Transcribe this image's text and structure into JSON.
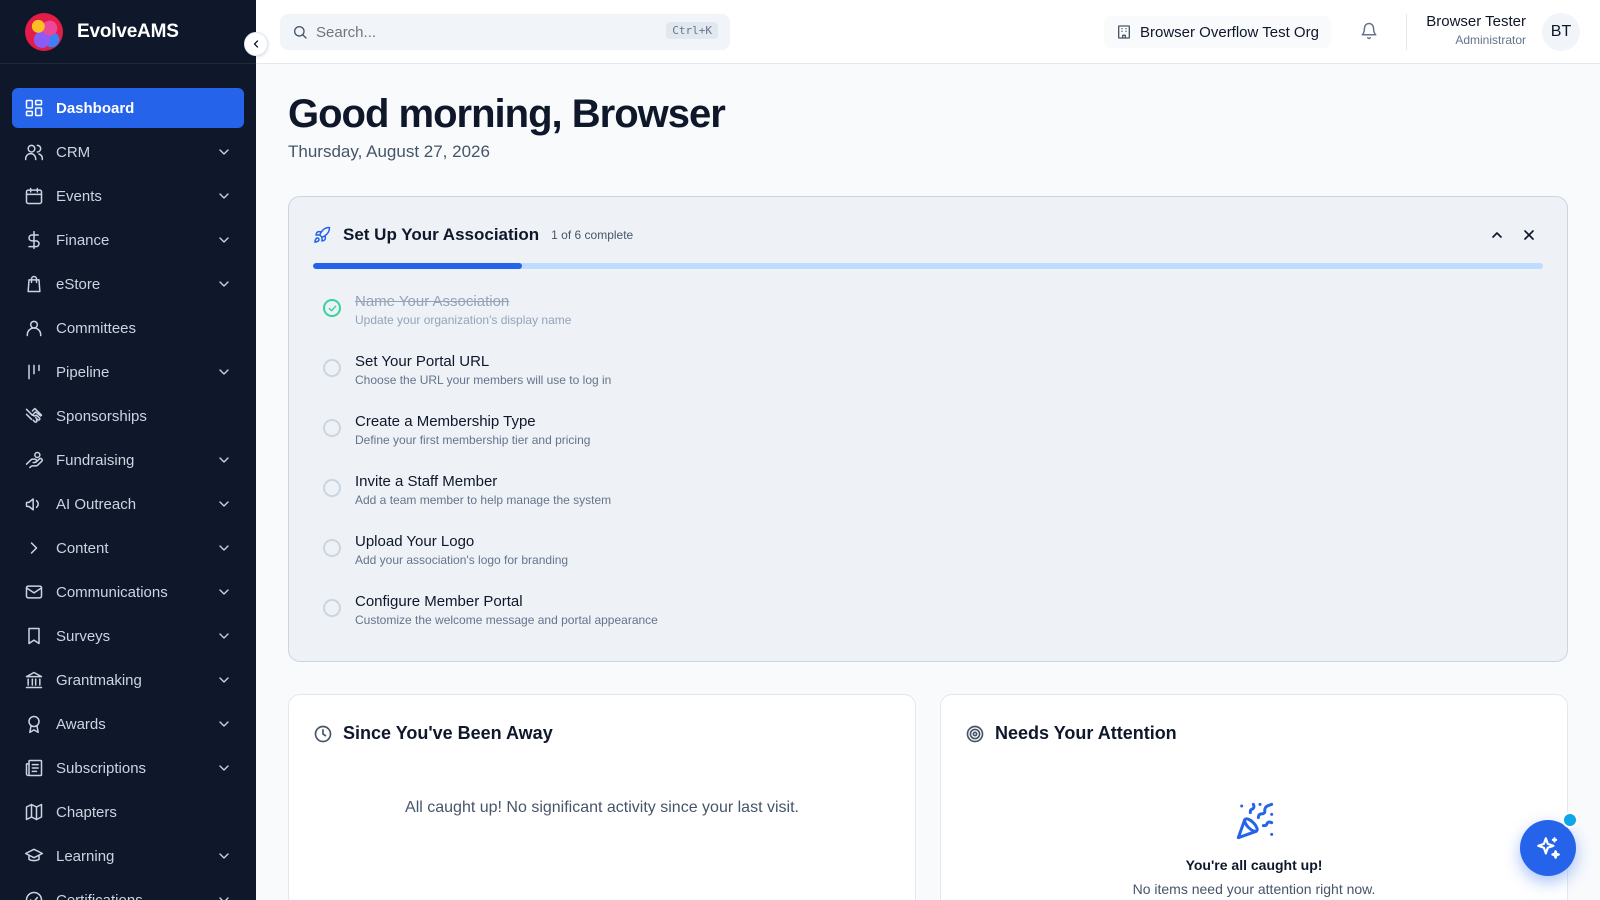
{
  "app": {
    "name": "EvolveAMS"
  },
  "sidebar": {
    "items": [
      {
        "label": "Dashboard",
        "icon": "dashboard-icon",
        "active": true,
        "has_chevron": false
      },
      {
        "label": "CRM",
        "icon": "users-icon",
        "has_chevron": true
      },
      {
        "label": "Events",
        "icon": "calendar-icon",
        "has_chevron": true
      },
      {
        "label": "Finance",
        "icon": "dollar-icon",
        "has_chevron": true
      },
      {
        "label": "eStore",
        "icon": "shopping-bag-icon",
        "has_chevron": true
      },
      {
        "label": "Committees",
        "icon": "people-icon",
        "has_chevron": false
      },
      {
        "label": "Pipeline",
        "icon": "kanban-icon",
        "has_chevron": true
      },
      {
        "label": "Sponsorships",
        "icon": "handshake-icon",
        "has_chevron": false
      },
      {
        "label": "Fundraising",
        "icon": "hand-coins-icon",
        "has_chevron": true
      },
      {
        "label": "AI Outreach",
        "icon": "megaphone-icon",
        "has_chevron": true
      },
      {
        "label": "Content",
        "icon": "chevron-right-icon",
        "has_chevron": true
      },
      {
        "label": "Communications",
        "icon": "mail-icon",
        "has_chevron": true
      },
      {
        "label": "Surveys",
        "icon": "bookmark-icon",
        "has_chevron": true
      },
      {
        "label": "Grantmaking",
        "icon": "landmark-icon",
        "has_chevron": true
      },
      {
        "label": "Awards",
        "icon": "award-icon",
        "has_chevron": true
      },
      {
        "label": "Subscriptions",
        "icon": "newspaper-icon",
        "has_chevron": true
      },
      {
        "label": "Chapters",
        "icon": "map-icon",
        "has_chevron": false
      },
      {
        "label": "Learning",
        "icon": "graduation-cap-icon",
        "has_chevron": true
      },
      {
        "label": "Certifications",
        "icon": "badge-check-icon",
        "has_chevron": true
      }
    ]
  },
  "topbar": {
    "search_placeholder": "Search...",
    "search_shortcut": "Ctrl+K",
    "org_name": "Browser Overflow Test Org",
    "user_name": "Browser Tester",
    "user_role": "Administrator",
    "user_initials": "BT"
  },
  "greeting": {
    "title": "Good morning, Browser",
    "date": "Thursday, August 27, 2026"
  },
  "setup": {
    "title": "Set Up Your Association",
    "progress_text": "1 of 6 complete",
    "progress_fraction": 0.17,
    "steps": [
      {
        "title": "Name Your Association",
        "desc": "Update your organization's display name",
        "done": true
      },
      {
        "title": "Set Your Portal URL",
        "desc": "Choose the URL your members will use to log in",
        "done": false
      },
      {
        "title": "Create a Membership Type",
        "desc": "Define your first membership tier and pricing",
        "done": false
      },
      {
        "title": "Invite a Staff Member",
        "desc": "Add a team member to help manage the system",
        "done": false
      },
      {
        "title": "Upload Your Logo",
        "desc": "Add your association's logo for branding",
        "done": false
      },
      {
        "title": "Configure Member Portal",
        "desc": "Customize the welcome message and portal appearance",
        "done": false
      }
    ]
  },
  "away": {
    "title": "Since You've Been Away",
    "empty": "All caught up! No significant activity since your last visit."
  },
  "attention": {
    "title": "Needs Your Attention",
    "empty_title": "You're all caught up!",
    "empty_sub": "No items need your attention right now."
  },
  "colors": {
    "sidebar_bg": "#0f172a",
    "accent": "#2563eb",
    "success": "#34d399"
  }
}
